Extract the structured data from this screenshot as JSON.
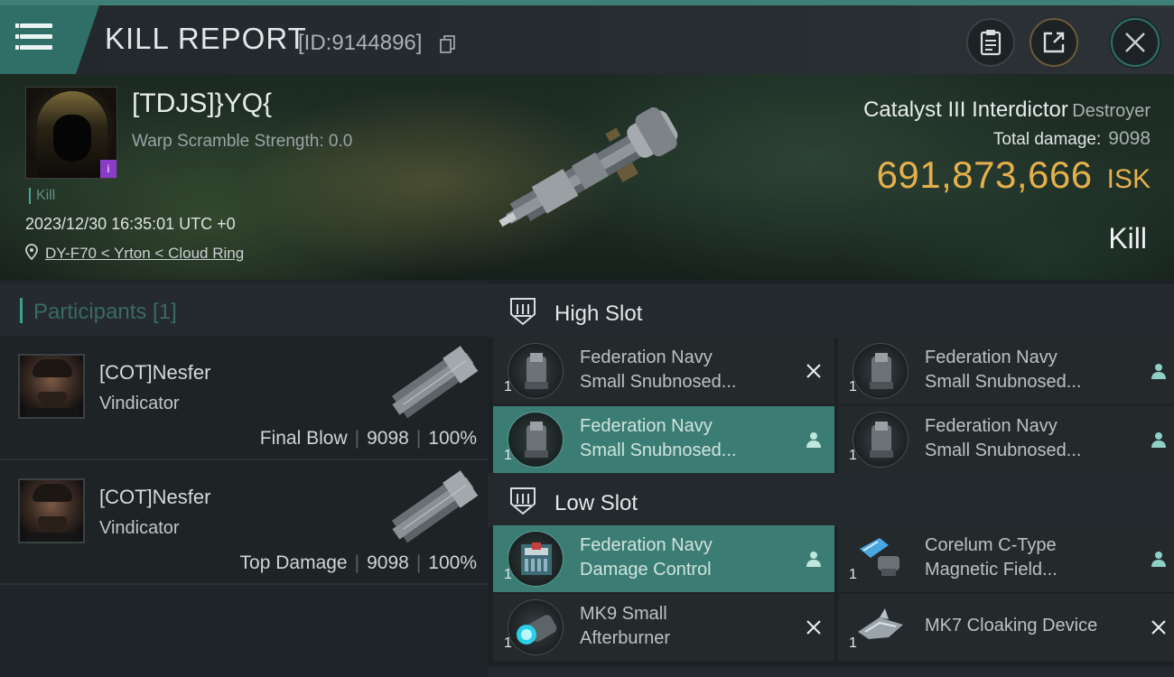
{
  "topbar": {
    "title": "KILL REPORT",
    "report_id": "[ID:9144896]"
  },
  "victim": {
    "name": "[TDJS]}YQ{",
    "warp_scramble": "Warp Scramble Strength: 0.0",
    "kill_tag": "Kill",
    "datetime": "2023/12/30 16:35:01 UTC +0",
    "location": "DY-F70 < Yrton < Cloud Ring",
    "corp_badge": "i",
    "ship_name": "Catalyst III Interdictor",
    "ship_class": "Destroyer",
    "total_damage_label": "Total damage:",
    "total_damage": "9098",
    "isk_value": "691,873,666",
    "isk_unit": "ISK",
    "result": "Kill"
  },
  "participants": {
    "heading": "Participants [1]",
    "rows": [
      {
        "name": "[COT]Nesfer",
        "ship": "Vindicator",
        "role": "Final Blow",
        "damage": "9098",
        "percent": "100%"
      },
      {
        "name": "[COT]Nesfer",
        "ship": "Vindicator",
        "role": "Top Damage",
        "damage": "9098",
        "percent": "100%"
      }
    ]
  },
  "slots": {
    "high": {
      "title": "High Slot",
      "items": [
        {
          "qty": "1",
          "line1": "Federation Navy",
          "line2": "Small Snubnosed...",
          "status": "destroyed"
        },
        {
          "qty": "1",
          "line1": "Federation Navy",
          "line2": "Small Snubnosed...",
          "status": "dropped"
        },
        {
          "qty": "1",
          "line1": "Federation Navy",
          "line2": "Small Snubnosed...",
          "status": "dropped"
        },
        {
          "qty": "1",
          "line1": "Federation Navy",
          "line2": "Small Snubnosed...",
          "status": "dropped"
        }
      ]
    },
    "low": {
      "title": "Low Slot",
      "items": [
        {
          "qty": "1",
          "line1": "Federation Navy",
          "line2": "Damage Control",
          "status": "dropped"
        },
        {
          "qty": "1",
          "line1": "Corelum C-Type",
          "line2": "Magnetic Field...",
          "status": "dropped"
        },
        {
          "qty": "1",
          "line1": "MK9 Small",
          "line2": "Afterburner",
          "status": "destroyed"
        },
        {
          "qty": "1",
          "line1": "MK7 Cloaking Device",
          "status": "destroyed"
        }
      ]
    }
  },
  "colors": {
    "accent": "#3b7d74",
    "isk": "#e5b04c",
    "topbar_stripe": "#3e7f78"
  },
  "icons": [
    "menu-icon",
    "copy-icon",
    "clipboard-icon",
    "share-icon",
    "close-icon",
    "location-pin-icon",
    "high-slot-icon",
    "low-slot-icon",
    "destroyed-x-icon",
    "dropped-person-icon"
  ]
}
